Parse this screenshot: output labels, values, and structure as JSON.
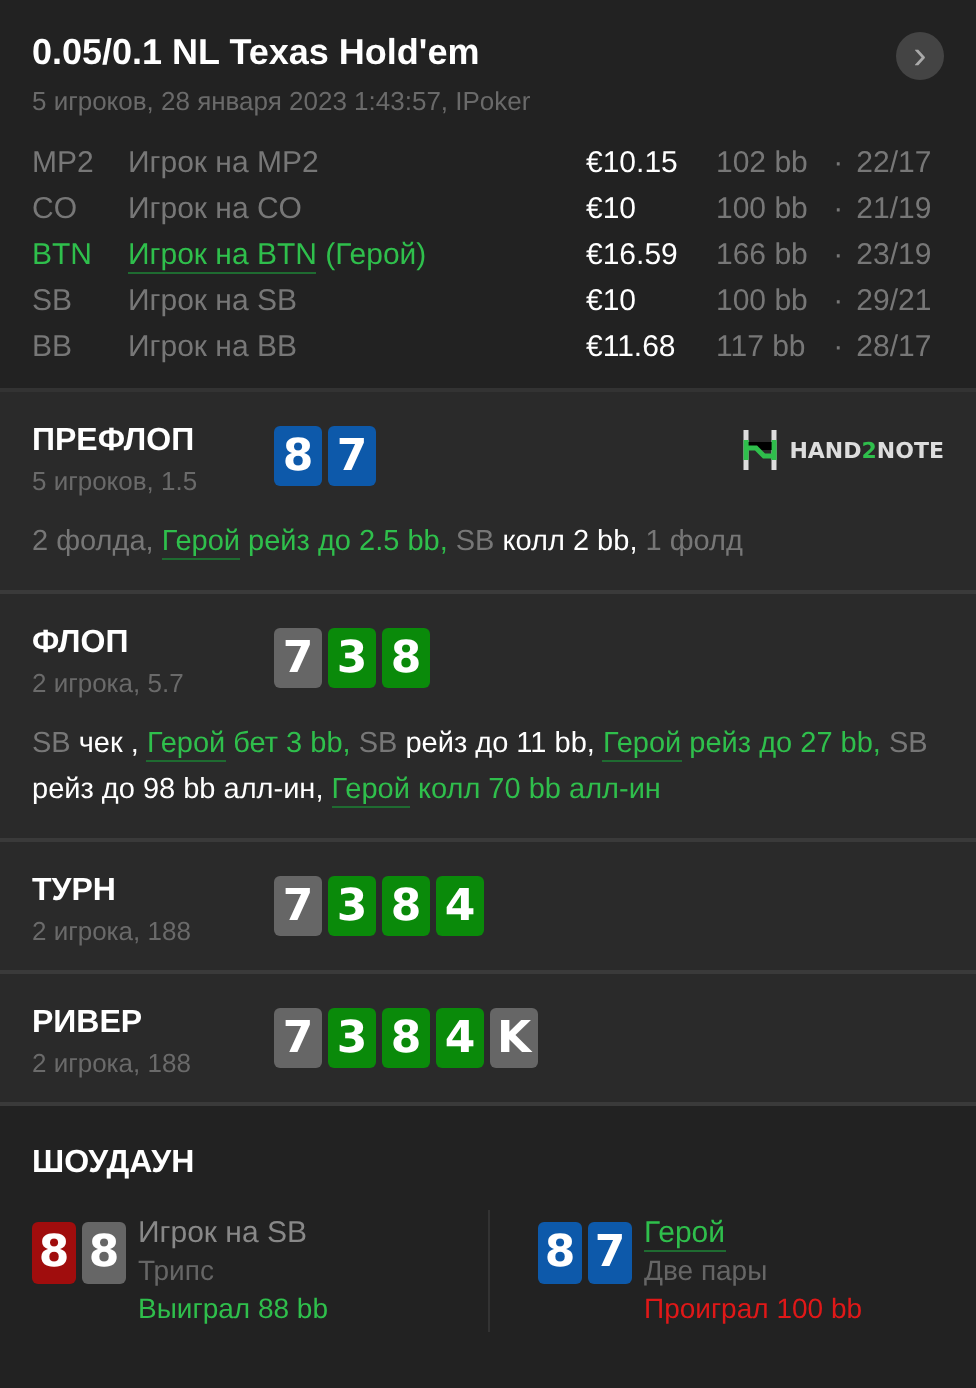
{
  "header": {
    "title": "0.05/0.1 NL Texas Hold'em",
    "subtitle": "5 игроков, 28 января 2023 1:43:57, IPoker",
    "next_icon": "›"
  },
  "players": [
    {
      "position": "MP2",
      "name": "Игрок на MP2",
      "hero": false,
      "stack": "€10.15",
      "bb": "102 bb",
      "separator": "·",
      "stats": "22/17"
    },
    {
      "position": "CO",
      "name": "Игрок на CO",
      "hero": false,
      "stack": "€10",
      "bb": "100 bb",
      "separator": "·",
      "stats": "21/19"
    },
    {
      "position": "BTN",
      "name": "Игрок на BTN",
      "hero": true,
      "hero_tag": "(Герой)",
      "stack": "€16.59",
      "bb": "166 bb",
      "separator": "·",
      "stats": "23/19"
    },
    {
      "position": "SB",
      "name": "Игрок на SB",
      "hero": false,
      "stack": "€10",
      "bb": "100 bb",
      "separator": "·",
      "stats": "29/21"
    },
    {
      "position": "BB",
      "name": "Игрок на BB",
      "hero": false,
      "stack": "€11.68",
      "bb": "117 bb",
      "separator": "·",
      "stats": "28/17"
    }
  ],
  "logo": {
    "start": "HAND",
    "middle": "2",
    "end": "NOTE"
  },
  "streets": [
    {
      "title": "ПРЕФЛОП",
      "subtitle": "5 игроков, 1.5",
      "logo": true,
      "cards": [
        {
          "rank": "8",
          "color": "#0d59aa"
        },
        {
          "rank": "7",
          "color": "#0d59aa"
        }
      ],
      "actions": [
        {
          "kind": "muted",
          "text": "2 фолда,"
        },
        {
          "kind": "hero",
          "text": "Герой"
        },
        {
          "kind": "hero_action",
          "text": "рейз до 2.5 bb,"
        },
        {
          "kind": "muted",
          "text": "SB"
        },
        {
          "kind": "action",
          "text": "колл 2 bb,"
        },
        {
          "kind": "muted",
          "text": "1 фолд"
        }
      ]
    },
    {
      "title": "ФЛОП",
      "subtitle": "2 игрока, 5.7",
      "logo": false,
      "cards": [
        {
          "rank": "7",
          "color": "#666666"
        },
        {
          "rank": "3",
          "color": "#0a8a0a"
        },
        {
          "rank": "8",
          "color": "#0a8a0a"
        }
      ],
      "actions": [
        {
          "kind": "muted",
          "text": "SB"
        },
        {
          "kind": "action",
          "text": "чек ,"
        },
        {
          "kind": "hero",
          "text": "Герой"
        },
        {
          "kind": "hero_action",
          "text": "бет 3 bb,"
        },
        {
          "kind": "muted",
          "text": "SB"
        },
        {
          "kind": "action",
          "text": "рейз до 11 bb,"
        },
        {
          "kind": "hero",
          "text": "Герой"
        },
        {
          "kind": "hero_action",
          "text": "рейз до 27 bb,"
        },
        {
          "kind": "muted",
          "text": "SB"
        },
        {
          "kind": "action",
          "text": "рейз до 98 bb алл-ин,"
        },
        {
          "kind": "hero",
          "text": "Герой"
        },
        {
          "kind": "hero_action",
          "text": "колл 70 bb алл-ин"
        }
      ]
    },
    {
      "title": "ТУРН",
      "subtitle": "2 игрока, 188",
      "logo": false,
      "cards": [
        {
          "rank": "7",
          "color": "#666666"
        },
        {
          "rank": "3",
          "color": "#0a8a0a"
        },
        {
          "rank": "8",
          "color": "#0a8a0a"
        },
        {
          "rank": "4",
          "color": "#0a8a0a"
        }
      ]
    },
    {
      "title": "РИВЕР",
      "subtitle": "2 игрока, 188",
      "logo": false,
      "cards": [
        {
          "rank": "7",
          "color": "#666666"
        },
        {
          "rank": "3",
          "color": "#0a8a0a"
        },
        {
          "rank": "8",
          "color": "#0a8a0a"
        },
        {
          "rank": "4",
          "color": "#0a8a0a"
        },
        {
          "rank": "K",
          "color": "#666666"
        }
      ]
    }
  ],
  "showdown": {
    "title": "ШОУДАУН",
    "players": [
      {
        "cards": [
          {
            "rank": "8",
            "color": "#a00d0d"
          },
          {
            "rank": "8",
            "color": "#666666"
          }
        ],
        "name": "Игрок на SB",
        "hero": false,
        "hand": "Трипс",
        "result": "Выиграл 88 bb",
        "won": true
      },
      {
        "cards": [
          {
            "rank": "8",
            "color": "#0d59aa"
          },
          {
            "rank": "7",
            "color": "#0d59aa"
          }
        ],
        "name": "Герой",
        "hero": true,
        "hand": "Две пары",
        "result": "Проиграл 100 bb",
        "won": false
      }
    ]
  }
}
